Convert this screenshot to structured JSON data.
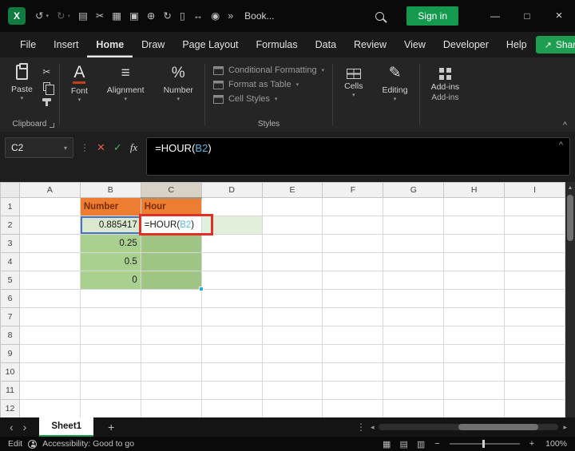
{
  "titlebar": {
    "logo_glyph": "X",
    "qat": [
      {
        "name": "undo-icon",
        "glyph": "↺"
      },
      {
        "name": "undo-dropdown-icon",
        "glyph": "▾",
        "caret": true
      },
      {
        "name": "redo-icon",
        "glyph": "↻",
        "dim": true
      },
      {
        "name": "redo-dropdown-icon",
        "glyph": "▾",
        "caret": true,
        "dim": true
      },
      {
        "name": "book-view-icon",
        "glyph": "▤"
      },
      {
        "name": "cut-icon",
        "glyph": "✂"
      },
      {
        "name": "image-icon",
        "glyph": "▦"
      },
      {
        "name": "print-icon",
        "glyph": "▣"
      },
      {
        "name": "draw-icon",
        "glyph": "⊕"
      },
      {
        "name": "repeat-icon",
        "glyph": "↻"
      },
      {
        "name": "document-icon",
        "glyph": "▯"
      },
      {
        "name": "fit-width-icon",
        "glyph": "↔"
      },
      {
        "name": "camera-icon",
        "glyph": "◉"
      },
      {
        "name": "qat-overflow-icon",
        "glyph": "»"
      }
    ],
    "document_title": "Book...",
    "sign_in_label": "Sign in",
    "minimize_glyph": "—",
    "maximize_glyph": "□",
    "close_glyph": "×"
  },
  "menu": {
    "tabs": [
      "File",
      "Insert",
      "Home",
      "Draw",
      "Page Layout",
      "Formulas",
      "Data",
      "Review",
      "View",
      "Developer",
      "Help"
    ],
    "active_tab": "Home",
    "share_label": "Share",
    "share_glyph": "↗"
  },
  "ribbon": {
    "paste_label": "Paste",
    "clipboard_label": "Clipboard",
    "font_label": "Font",
    "alignment_label": "Alignment",
    "number_label": "Number",
    "styles": {
      "conditional_formatting_label": "Conditional Formatting",
      "format_as_table_label": "Format as Table",
      "cell_styles_label": "Cell Styles",
      "group_label": "Styles"
    },
    "cells_label": "Cells",
    "editing_label": "Editing",
    "addins_label": "Add-ins",
    "addins_group_label": "Add-ins"
  },
  "formula_bar": {
    "name_box_value": "C2",
    "cancel_glyph": "✕",
    "enter_glyph": "✓",
    "fx_label": "fx",
    "formula_prefix": "=HOUR(",
    "formula_reference": "B2",
    "formula_suffix": ")"
  },
  "grid": {
    "columns": [
      "A",
      "B",
      "C",
      "D",
      "E",
      "F",
      "G",
      "H",
      "I"
    ],
    "rows": [
      "1",
      "2",
      "3",
      "4",
      "5",
      "6",
      "7",
      "8",
      "9",
      "10",
      "11",
      "12"
    ],
    "selected_column": "C",
    "cells": [
      {
        "ref": "B1",
        "text": "Number",
        "cls": "c-orange"
      },
      {
        "ref": "C1",
        "text": "Hour",
        "cls": "c-orange"
      },
      {
        "ref": "B2",
        "text": "0.885417",
        "cls": "c-green-light num"
      },
      {
        "ref": "B3",
        "text": "0.25",
        "cls": "c-green num"
      },
      {
        "ref": "B4",
        "text": "0.5",
        "cls": "c-green num"
      },
      {
        "ref": "B5",
        "text": "0",
        "cls": "c-green num"
      },
      {
        "ref": "C2",
        "text": "=HOUR(B2)",
        "cls": "c-edit"
      },
      {
        "ref": "C3",
        "text": "",
        "cls": "c-green-dark"
      },
      {
        "ref": "C4",
        "text": "",
        "cls": "c-green-dark"
      },
      {
        "ref": "C5",
        "text": "",
        "cls": "c-green-dark"
      },
      {
        "ref": "D2",
        "text": "",
        "cls": "c-pale"
      }
    ],
    "edit_cell": {
      "ref": "C2",
      "prefix": "=HOUR(",
      "reference": "B2",
      "suffix": ")"
    }
  },
  "sheet_bar": {
    "nav_left": "‹",
    "nav_right": "›",
    "active_tab_label": "Sheet1",
    "add_glyph": "+"
  },
  "status_bar": {
    "mode_label": "Edit",
    "accessibility_label": "Accessibility: Good to go",
    "zoom_out_glyph": "−",
    "zoom_in_glyph": "+",
    "zoom_label": "100%"
  },
  "icons": {
    "caret": "▾",
    "dots": "⋮",
    "up_arrow": "▲",
    "left_tri": "◂",
    "right_tri": "▸",
    "cut": "✂",
    "align": "≡",
    "percent": "%",
    "font_a": "A",
    "pencil": "✎",
    "view_normal": "▦",
    "view_layout": "▤",
    "view_break": "▥"
  },
  "colors": {
    "accent_green": "#1E9E50",
    "header_orange": "#ED7D31",
    "cell_green": "#A9D08E",
    "cell_green_light": "#D9E7CC",
    "cell_pale_green": "#E2EFDA",
    "reference_blue": "#2B9BD7",
    "annotation_red": "#E02F24"
  }
}
